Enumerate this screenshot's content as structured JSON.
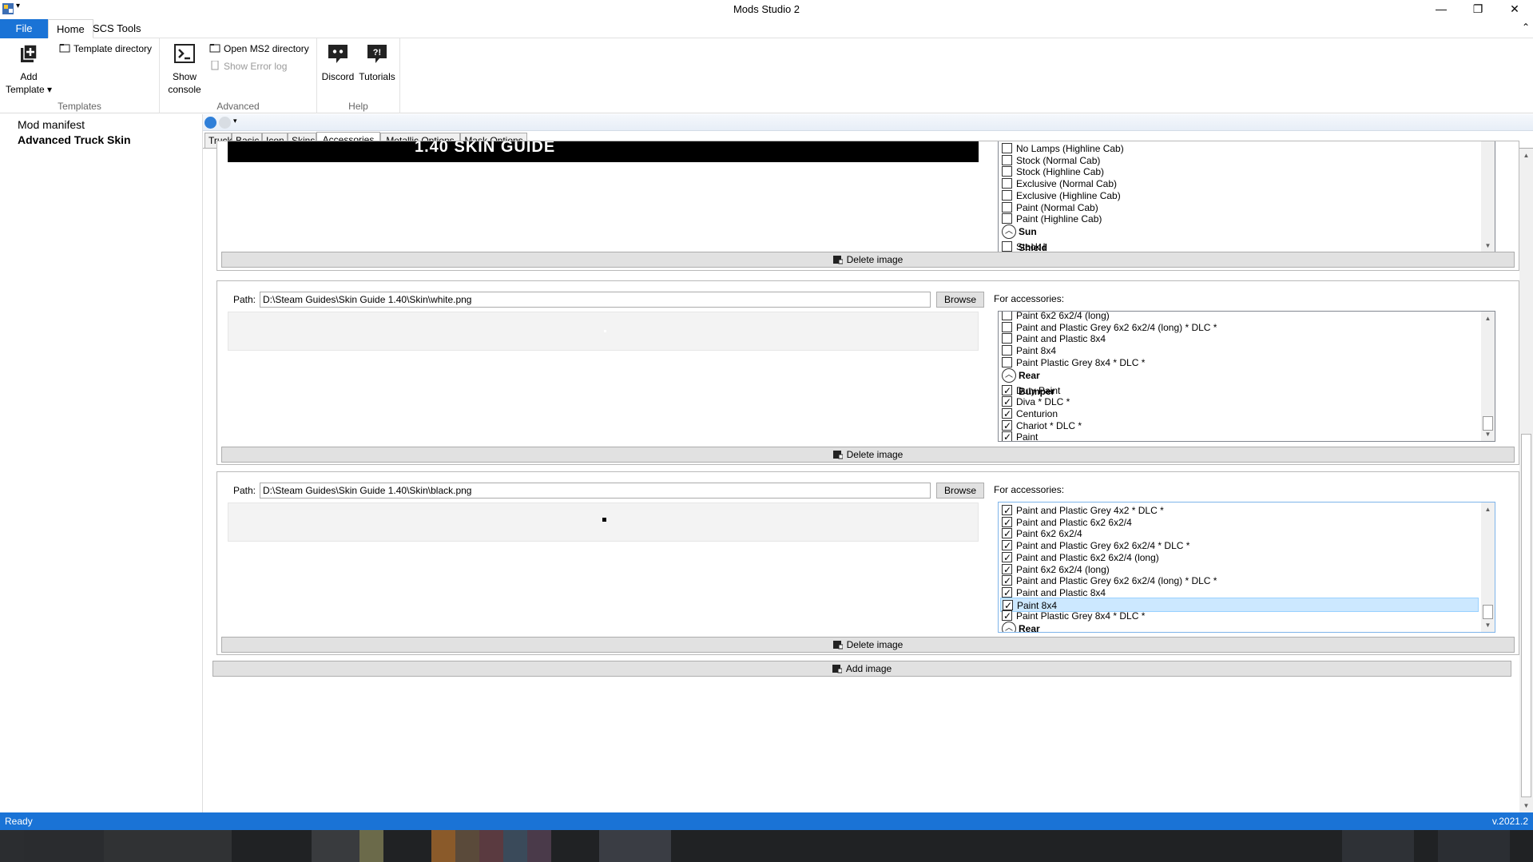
{
  "window": {
    "title": "Mods Studio 2",
    "minimize": "—",
    "restore": "❐",
    "close": "✕"
  },
  "ribbon": {
    "tabs": {
      "file": "File",
      "home": "Home",
      "scs": "SCS Tools"
    },
    "templates": {
      "add_template": "Add",
      "add_template_2": "Template ▾",
      "template_directory": "Template directory",
      "label": "Templates"
    },
    "advanced": {
      "show_console": "Show",
      "show_console_2": "console",
      "open_ms2": "Open MS2 directory",
      "show_error_log": "Show Error log",
      "label": "Advanced"
    },
    "help": {
      "discord": "Discord",
      "tutorials": "Tutorials",
      "label": "Help"
    }
  },
  "tree": {
    "item1": "Mod manifest",
    "item2": "Advanced Truck Skin"
  },
  "tabs": [
    "Truck",
    "Basic",
    "Icon",
    "Skins",
    "Accessories",
    "Metallic Options",
    "Mask Options"
  ],
  "panel1": {
    "preview_text": "1.40 SKIN GUIDE",
    "list": [
      {
        "type": "item",
        "label": "No Lamps (Highline Cab)",
        "checked": false
      },
      {
        "type": "item",
        "label": "Stock (Normal Cab)",
        "checked": false
      },
      {
        "type": "item",
        "label": "Stock (Highline Cab)",
        "checked": false
      },
      {
        "type": "item",
        "label": "Exclusive (Normal Cab)",
        "checked": false
      },
      {
        "type": "item",
        "label": "Exclusive (Highline Cab)",
        "checked": false
      },
      {
        "type": "item",
        "label": "Paint (Normal Cab)",
        "checked": false
      },
      {
        "type": "item",
        "label": "Paint (Highline Cab)",
        "checked": false
      },
      {
        "type": "header",
        "label": "Sun Shield"
      },
      {
        "type": "item",
        "label": "Stock I",
        "checked": false
      }
    ],
    "delete": "Delete image"
  },
  "panel2": {
    "path_label": "Path:",
    "path": "D:\\Steam Guides\\Skin Guide 1.40\\Skin\\white.png",
    "browse": "Browse",
    "for_acc": "For accessories:",
    "list": [
      {
        "type": "item",
        "label": "Paint 6x2 6x2/4 (long)",
        "checked": false
      },
      {
        "type": "item",
        "label": "Paint and Plastic Grey 6x2 6x2/4 (long) * DLC *",
        "checked": false
      },
      {
        "type": "item",
        "label": "Paint and Plastic 8x4",
        "checked": false
      },
      {
        "type": "item",
        "label": "Paint 8x4",
        "checked": false
      },
      {
        "type": "item",
        "label": "Paint Plastic Grey 8x4 * DLC *",
        "checked": false
      },
      {
        "type": "header",
        "label": "Rear Bumper"
      },
      {
        "type": "item",
        "label": "Duty Paint",
        "checked": true
      },
      {
        "type": "item",
        "label": "Diva * DLC *",
        "checked": true
      },
      {
        "type": "item",
        "label": "Centurion",
        "checked": true
      },
      {
        "type": "item",
        "label": "Chariot * DLC *",
        "checked": true
      },
      {
        "type": "item",
        "label": "Paint",
        "checked": true
      }
    ],
    "delete": "Delete image"
  },
  "panel3": {
    "path_label": "Path:",
    "path": "D:\\Steam Guides\\Skin Guide 1.40\\Skin\\black.png",
    "browse": "Browse",
    "for_acc": "For accessories:",
    "list": [
      {
        "type": "item",
        "label": "Paint and Plastic Grey 4x2 * DLC *",
        "checked": true
      },
      {
        "type": "item",
        "label": "Paint and Plastic 6x2 6x2/4",
        "checked": true
      },
      {
        "type": "item",
        "label": "Paint 6x2 6x2/4",
        "checked": true
      },
      {
        "type": "item",
        "label": "Paint and Plastic Grey 6x2 6x2/4 * DLC *",
        "checked": true
      },
      {
        "type": "item",
        "label": "Paint and Plastic 6x2 6x2/4 (long)",
        "checked": true
      },
      {
        "type": "item",
        "label": "Paint 6x2 6x2/4 (long)",
        "checked": true
      },
      {
        "type": "item",
        "label": "Paint and Plastic Grey 6x2 6x2/4 (long) * DLC *",
        "checked": true
      },
      {
        "type": "item",
        "label": "Paint and Plastic 8x4",
        "checked": true
      },
      {
        "type": "item",
        "label": "Paint 8x4",
        "checked": true,
        "selected": true
      },
      {
        "type": "item",
        "label": "Paint Plastic Grey 8x4 * DLC *",
        "checked": true
      },
      {
        "type": "header",
        "label": "Rear Bumper"
      }
    ],
    "delete": "Delete image"
  },
  "add_image": "Add image",
  "status": {
    "left": "Ready",
    "right": "v.2021.2"
  },
  "colors": {
    "accent": "#1a73d6",
    "selection": "#cce8ff"
  }
}
